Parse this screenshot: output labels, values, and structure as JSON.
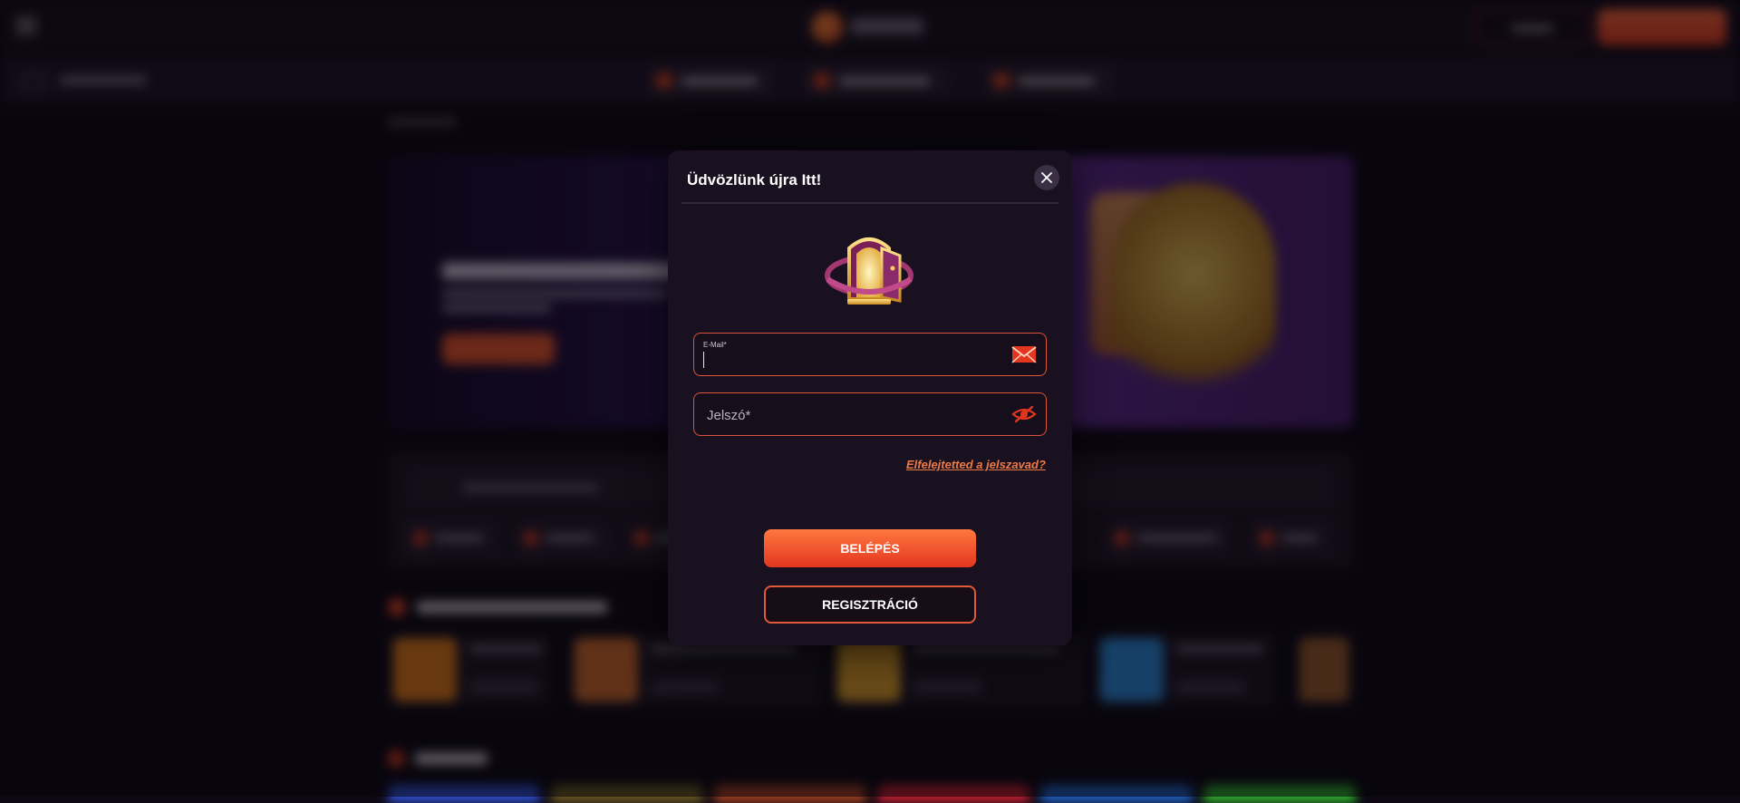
{
  "modal": {
    "title": "Üdvözlünk újra Itt!",
    "email_label": "E-Mail*",
    "email_value": "",
    "password_placeholder": "Jelszó*",
    "forgot_password": "Elfelejtetted a jelszavad?",
    "login_button": "BELÉPÉS",
    "register_button": "REGISZTRÁCIÓ"
  },
  "icons": {
    "close": "close-icon",
    "email": "envelope-icon",
    "password_toggle": "eye-slash-icon",
    "header": "door-portal-icon",
    "menu": "hamburger-icon"
  },
  "colors": {
    "accent": "#e2361f",
    "accent_light": "#ff7840",
    "link": "#ee7b45",
    "modal_bg": "#1a1120",
    "page_bg": "#0d0813"
  }
}
